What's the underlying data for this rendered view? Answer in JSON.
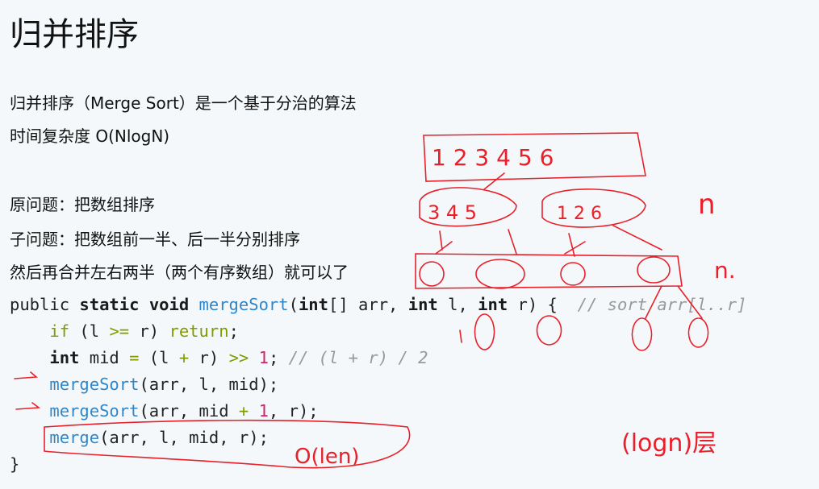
{
  "title": "归并排序",
  "intro": [
    "归并排序（Merge Sort）是一个基于分治的算法",
    "时间复杂度 O(NlogN)"
  ],
  "problem": [
    "原问题：把数组排序",
    "子问题：把数组前一半、后一半分别排序",
    "然后再合并左右两半（两个有序数组）就可以了"
  ],
  "code": {
    "l1": {
      "a": "public ",
      "b": "static ",
      "c": "void ",
      "d": "mergeSort",
      "e": "(",
      "f": "int",
      "g": "[] arr, ",
      "h": "int",
      "i": " l, ",
      "j": "int",
      "k": " r) {  ",
      "cm": "// sort arr[l..r]"
    },
    "l2": {
      "if": "if",
      "a": " (l ",
      ">=": ">=",
      "b": " r) ",
      "ret": "return",
      "c": ";"
    },
    "l3": {
      "int": "int",
      "a": " mid ",
      "eq": "=",
      "b": " (l ",
      "plus": "+",
      "c": " r) ",
      "shr": ">>",
      "sp": " ",
      "one": "1",
      "d": "; ",
      "cm": "// (l + r) / 2"
    },
    "l4": {
      "fn": "mergeSort",
      "a": "(arr, l, mid);"
    },
    "l5": {
      "fn": "mergeSort",
      "a": "(arr, mid ",
      "plus": "+",
      "sp": " ",
      "one": "1",
      "b": ", r);"
    },
    "l6": {
      "fn": "merge",
      "a": "(arr, l, mid, r);"
    },
    "l7": "}"
  },
  "ink_color": "#e8202a"
}
